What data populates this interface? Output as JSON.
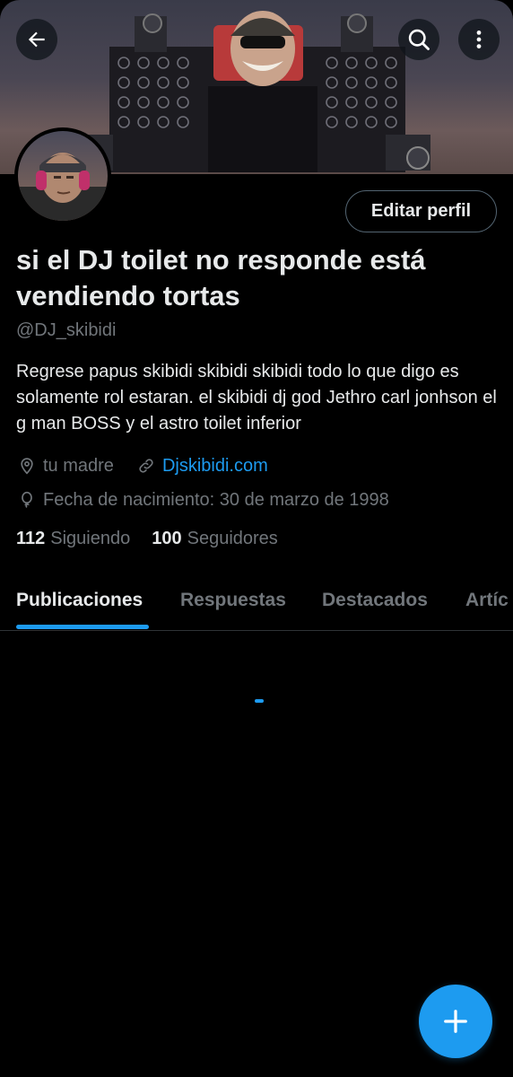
{
  "header": {
    "back_icon": "arrow-left-icon",
    "search_icon": "search-icon",
    "more_icon": "more-vertical-icon"
  },
  "profile": {
    "display_name": "si el DJ toilet no responde está vendiendo tortas",
    "handle": "@DJ_skibidi",
    "bio": "Regrese papus skibidi skibidi skibidi todo lo que digo es solamente rol estaran. el skibidi dj god Jethro carl jonhson  el g man BOSS y el astro toilet inferior",
    "location": "tu madre",
    "website": "Djskibidi.com",
    "birthday": "Fecha de nacimiento: 30 de marzo de 1998",
    "following_count": "112",
    "following_label": "Siguiendo",
    "followers_count": "100",
    "followers_label": "Seguidores",
    "edit_button": "Editar perfil"
  },
  "tabs": [
    {
      "label": "Publicaciones",
      "active": true
    },
    {
      "label": "Respuestas",
      "active": false
    },
    {
      "label": "Destacados",
      "active": false
    },
    {
      "label": "Artíc",
      "active": false
    }
  ],
  "colors": {
    "accent": "#1d9bf0",
    "background": "#000000",
    "text_primary": "#e7e9ea",
    "text_secondary": "#71767b"
  }
}
